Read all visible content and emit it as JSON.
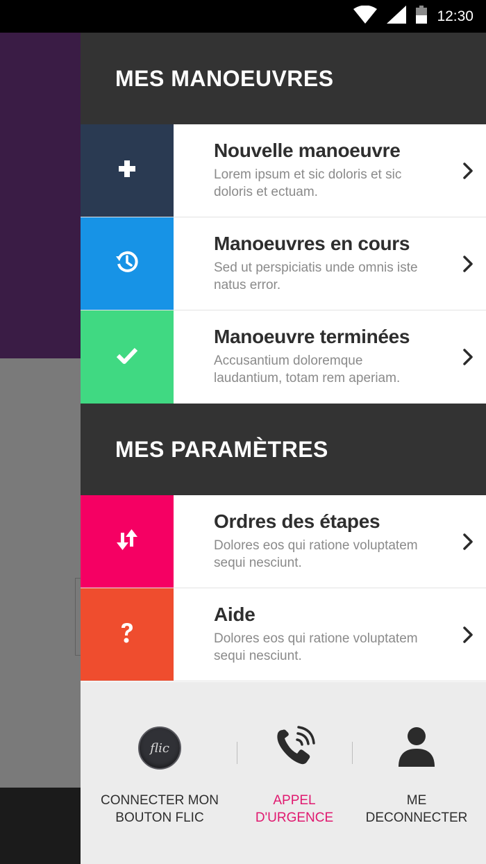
{
  "status_bar": {
    "time": "12:30",
    "icons": [
      "wifi-icon",
      "signal-icon",
      "battery-icon"
    ]
  },
  "drawer": {
    "sections": [
      {
        "title": "MES MANOEUVRES",
        "items": [
          {
            "title": "Nouvelle manoeuvre",
            "description": "Lorem ipsum et sic doloris et sic doloris et ectuam.",
            "icon": "plus-icon",
            "color": "#2a3a52"
          },
          {
            "title": "Manoeuvres en cours",
            "description": "Sed ut perspiciatis unde omnis iste natus error.",
            "icon": "history-clock-icon",
            "color": "#1793e6"
          },
          {
            "title": "Manoeuvre terminées",
            "description": "Accusantium doloremque laudantium, totam rem aperiam.",
            "icon": "check-icon",
            "color": "#40d982"
          }
        ]
      },
      {
        "title": "MES PARAMÈTRES",
        "items": [
          {
            "title": "Ordres des étapes",
            "description": "Dolores eos qui ratione voluptatem sequi nesciunt.",
            "icon": "sort-arrows-icon",
            "color": "#f50063"
          },
          {
            "title": "Aide",
            "description": "Dolores eos qui ratione voluptatem sequi nesciunt.",
            "icon": "question-icon",
            "color": "#ef4d2e"
          }
        ]
      }
    ],
    "footer": {
      "connect_label": "CONNECTER MON BOUTON FLIC",
      "flic_logo_text": "flic",
      "emergency_label": "APPEL D'URGENCE",
      "logout_label": "ME DECONNECTER",
      "emergency_color": "#e0196f"
    }
  }
}
